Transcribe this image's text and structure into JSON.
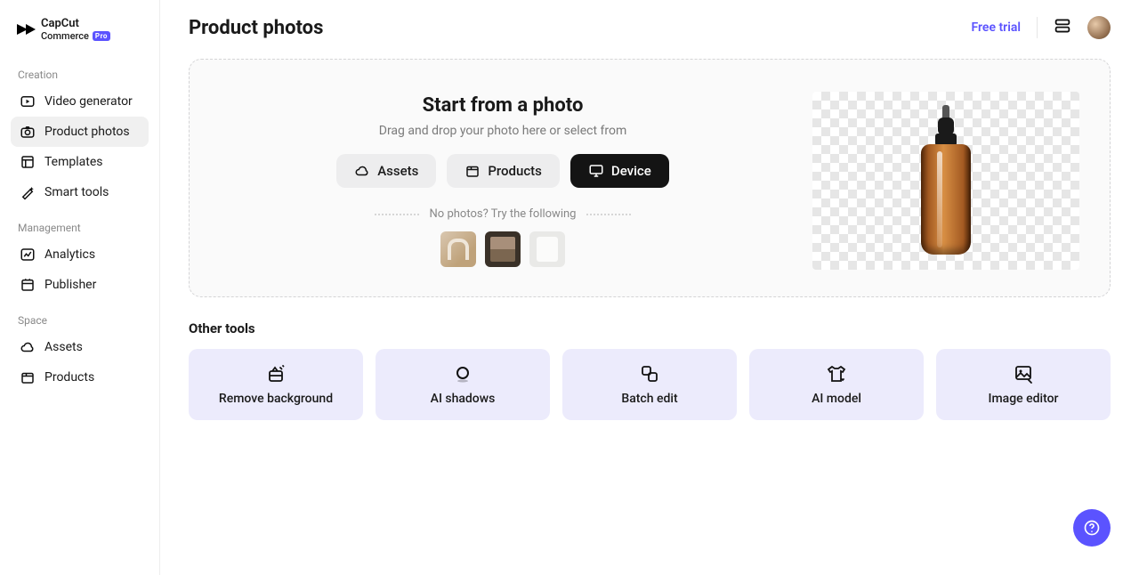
{
  "brand": {
    "name": "CapCut",
    "line2": "Commerce",
    "badge": "Pro"
  },
  "sidebar": {
    "sections": [
      {
        "label": "Creation",
        "items": [
          {
            "label": "Video generator",
            "icon": "video-play-icon",
            "active": false
          },
          {
            "label": "Product photos",
            "icon": "camera-icon",
            "active": true
          },
          {
            "label": "Templates",
            "icon": "template-icon",
            "active": false
          },
          {
            "label": "Smart tools",
            "icon": "magic-icon",
            "active": false
          }
        ]
      },
      {
        "label": "Management",
        "items": [
          {
            "label": "Analytics",
            "icon": "chart-icon",
            "active": false
          },
          {
            "label": "Publisher",
            "icon": "calendar-icon",
            "active": false
          }
        ]
      },
      {
        "label": "Space",
        "items": [
          {
            "label": "Assets",
            "icon": "cloud-icon",
            "active": false
          },
          {
            "label": "Products",
            "icon": "package-icon",
            "active": false
          }
        ]
      }
    ]
  },
  "header": {
    "title": "Product photos",
    "free_trial": "Free trial"
  },
  "upload": {
    "title": "Start from a photo",
    "subtitle": "Drag and drop your photo here or select from",
    "sources": [
      {
        "label": "Assets",
        "icon": "cloud-icon",
        "variant": "light"
      },
      {
        "label": "Products",
        "icon": "package-icon",
        "variant": "light"
      },
      {
        "label": "Device",
        "icon": "monitor-icon",
        "variant": "dark"
      }
    ],
    "nophotos": "No photos? Try the following",
    "samples": [
      {
        "name": "sample-headphones"
      },
      {
        "name": "sample-palette"
      },
      {
        "name": "sample-shirt"
      }
    ],
    "preview": {
      "name": "product-bottle-preview"
    }
  },
  "other_tools": {
    "title": "Other tools",
    "items": [
      {
        "label": "Remove background",
        "icon": "erase-icon"
      },
      {
        "label": "AI shadows",
        "icon": "circle-icon"
      },
      {
        "label": "Batch edit",
        "icon": "batch-icon"
      },
      {
        "label": "AI model",
        "icon": "tshirt-icon"
      },
      {
        "label": "Image editor",
        "icon": "image-icon"
      }
    ]
  }
}
